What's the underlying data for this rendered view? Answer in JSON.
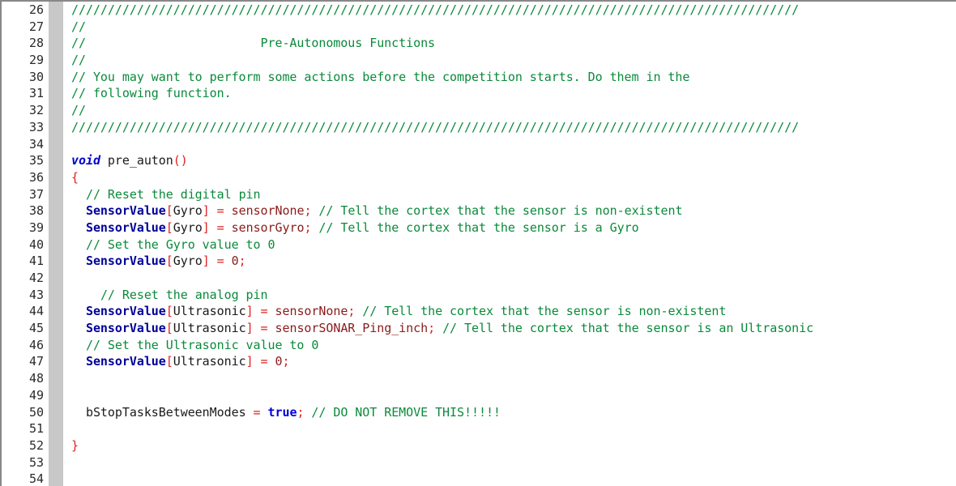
{
  "app": {
    "kind": "code-editor",
    "language": "C",
    "theme": "light"
  },
  "colors": {
    "background": "#ffffff",
    "gutter_background": "#ffffff",
    "fold_strip": "#c8c8c8",
    "border": "#888888",
    "comment": "#0a8a3a",
    "keyword": "#0000cc",
    "type": "#000099",
    "boolean": "#0000dd",
    "punctuation": "#dd2222",
    "operator": "#dd2222",
    "constant": "#8b1a1a",
    "identifier": "#1a1a1a",
    "line_number": "#2a2a2a"
  },
  "editor": {
    "first_visible_line": 26,
    "last_visible_line": 54,
    "line_count_visible": 29
  },
  "lines": [
    {
      "number": "26",
      "tokens": [
        {
          "t": "comment",
          "s": "////////////////////////////////////////////////////////////////////////////////////////////////////"
        }
      ]
    },
    {
      "number": "27",
      "tokens": [
        {
          "t": "comment",
          "s": "//"
        }
      ]
    },
    {
      "number": "28",
      "tokens": [
        {
          "t": "comment",
          "s": "//                        Pre-Autonomous Functions"
        }
      ]
    },
    {
      "number": "29",
      "tokens": [
        {
          "t": "comment",
          "s": "//"
        }
      ]
    },
    {
      "number": "30",
      "tokens": [
        {
          "t": "comment",
          "s": "// You may want to perform some actions before the competition starts. Do them in the"
        }
      ]
    },
    {
      "number": "31",
      "tokens": [
        {
          "t": "comment",
          "s": "// following function."
        }
      ]
    },
    {
      "number": "32",
      "tokens": [
        {
          "t": "comment",
          "s": "//"
        }
      ]
    },
    {
      "number": "33",
      "tokens": [
        {
          "t": "comment",
          "s": "////////////////////////////////////////////////////////////////////////////////////////////////////"
        }
      ]
    },
    {
      "number": "34",
      "tokens": []
    },
    {
      "number": "35",
      "tokens": [
        {
          "t": "keyword",
          "s": "void"
        },
        {
          "t": "plain",
          "s": " pre_auton"
        },
        {
          "t": "punct",
          "s": "()"
        }
      ]
    },
    {
      "number": "36",
      "tokens": [
        {
          "t": "punct",
          "s": "{"
        }
      ]
    },
    {
      "number": "37",
      "tokens": [
        {
          "t": "plain",
          "s": "  "
        },
        {
          "t": "comment",
          "s": "// Reset the digital pin"
        }
      ]
    },
    {
      "number": "38",
      "tokens": [
        {
          "t": "plain",
          "s": "  "
        },
        {
          "t": "type",
          "s": "SensorValue"
        },
        {
          "t": "punct",
          "s": "["
        },
        {
          "t": "ident",
          "s": "Gyro"
        },
        {
          "t": "punct",
          "s": "]"
        },
        {
          "t": "plain",
          "s": " "
        },
        {
          "t": "op",
          "s": "="
        },
        {
          "t": "plain",
          "s": " "
        },
        {
          "t": "const",
          "s": "sensorNone"
        },
        {
          "t": "punct",
          "s": ";"
        },
        {
          "t": "plain",
          "s": " "
        },
        {
          "t": "comment",
          "s": "// Tell the cortex that the sensor is non-existent"
        }
      ]
    },
    {
      "number": "39",
      "tokens": [
        {
          "t": "plain",
          "s": "  "
        },
        {
          "t": "type",
          "s": "SensorValue"
        },
        {
          "t": "punct",
          "s": "["
        },
        {
          "t": "ident",
          "s": "Gyro"
        },
        {
          "t": "punct",
          "s": "]"
        },
        {
          "t": "plain",
          "s": " "
        },
        {
          "t": "op",
          "s": "="
        },
        {
          "t": "plain",
          "s": " "
        },
        {
          "t": "const",
          "s": "sensorGyro"
        },
        {
          "t": "punct",
          "s": ";"
        },
        {
          "t": "plain",
          "s": " "
        },
        {
          "t": "comment",
          "s": "// Tell the cortex that the sensor is a Gyro"
        }
      ]
    },
    {
      "number": "40",
      "tokens": [
        {
          "t": "plain",
          "s": "  "
        },
        {
          "t": "comment",
          "s": "// Set the Gyro value to 0"
        }
      ]
    },
    {
      "number": "41",
      "tokens": [
        {
          "t": "plain",
          "s": "  "
        },
        {
          "t": "type",
          "s": "SensorValue"
        },
        {
          "t": "punct",
          "s": "["
        },
        {
          "t": "ident",
          "s": "Gyro"
        },
        {
          "t": "punct",
          "s": "]"
        },
        {
          "t": "plain",
          "s": " "
        },
        {
          "t": "op",
          "s": "="
        },
        {
          "t": "plain",
          "s": " "
        },
        {
          "t": "number",
          "s": "0"
        },
        {
          "t": "punct",
          "s": ";"
        }
      ]
    },
    {
      "number": "42",
      "tokens": []
    },
    {
      "number": "43",
      "tokens": [
        {
          "t": "plain",
          "s": "    "
        },
        {
          "t": "comment",
          "s": "// Reset the analog pin"
        }
      ]
    },
    {
      "number": "44",
      "tokens": [
        {
          "t": "plain",
          "s": "  "
        },
        {
          "t": "type",
          "s": "SensorValue"
        },
        {
          "t": "punct",
          "s": "["
        },
        {
          "t": "ident",
          "s": "Ultrasonic"
        },
        {
          "t": "punct",
          "s": "]"
        },
        {
          "t": "plain",
          "s": " "
        },
        {
          "t": "op",
          "s": "="
        },
        {
          "t": "plain",
          "s": " "
        },
        {
          "t": "const",
          "s": "sensorNone"
        },
        {
          "t": "punct",
          "s": ";"
        },
        {
          "t": "plain",
          "s": " "
        },
        {
          "t": "comment",
          "s": "// Tell the cortex that the sensor is non-existent"
        }
      ]
    },
    {
      "number": "45",
      "tokens": [
        {
          "t": "plain",
          "s": "  "
        },
        {
          "t": "type",
          "s": "SensorValue"
        },
        {
          "t": "punct",
          "s": "["
        },
        {
          "t": "ident",
          "s": "Ultrasonic"
        },
        {
          "t": "punct",
          "s": "]"
        },
        {
          "t": "plain",
          "s": " "
        },
        {
          "t": "op",
          "s": "="
        },
        {
          "t": "plain",
          "s": " "
        },
        {
          "t": "const",
          "s": "sensorSONAR_Ping_inch"
        },
        {
          "t": "punct",
          "s": ";"
        },
        {
          "t": "plain",
          "s": " "
        },
        {
          "t": "comment",
          "s": "// Tell the cortex that the sensor is an Ultrasonic"
        }
      ]
    },
    {
      "number": "46",
      "tokens": [
        {
          "t": "plain",
          "s": "  "
        },
        {
          "t": "comment",
          "s": "// Set the Ultrasonic value to 0"
        }
      ]
    },
    {
      "number": "47",
      "tokens": [
        {
          "t": "plain",
          "s": "  "
        },
        {
          "t": "type",
          "s": "SensorValue"
        },
        {
          "t": "punct",
          "s": "["
        },
        {
          "t": "ident",
          "s": "Ultrasonic"
        },
        {
          "t": "punct",
          "s": "]"
        },
        {
          "t": "plain",
          "s": " "
        },
        {
          "t": "op",
          "s": "="
        },
        {
          "t": "plain",
          "s": " "
        },
        {
          "t": "number",
          "s": "0"
        },
        {
          "t": "punct",
          "s": ";"
        }
      ]
    },
    {
      "number": "48",
      "tokens": []
    },
    {
      "number": "49",
      "tokens": []
    },
    {
      "number": "50",
      "tokens": [
        {
          "t": "plain",
          "s": "  "
        },
        {
          "t": "ident",
          "s": "bStopTasksBetweenModes"
        },
        {
          "t": "plain",
          "s": " "
        },
        {
          "t": "op",
          "s": "="
        },
        {
          "t": "plain",
          "s": " "
        },
        {
          "t": "bool",
          "s": "true"
        },
        {
          "t": "punct",
          "s": ";"
        },
        {
          "t": "plain",
          "s": " "
        },
        {
          "t": "comment",
          "s": "// DO NOT REMOVE THIS!!!!!"
        }
      ]
    },
    {
      "number": "51",
      "tokens": []
    },
    {
      "number": "52",
      "tokens": [
        {
          "t": "punct",
          "s": "}"
        }
      ]
    },
    {
      "number": "53",
      "tokens": []
    },
    {
      "number": "54",
      "tokens": []
    }
  ]
}
